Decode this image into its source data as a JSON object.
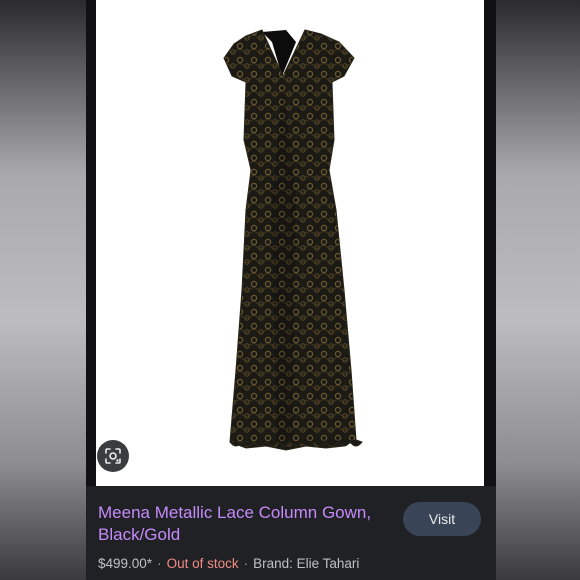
{
  "product": {
    "title": "Meena Metallic Lace Column Gown, Black/Gold",
    "price": "$499.00*",
    "stock_status": "Out of stock",
    "brand": "Brand: Elie Tahari"
  },
  "actions": {
    "visit_label": "Visit",
    "lens_icon": "lens-search-icon"
  },
  "colors": {
    "title": "#c58af9",
    "out_of_stock": "#f28b82",
    "panel_bg": "#202124",
    "button_bg": "#394457"
  }
}
